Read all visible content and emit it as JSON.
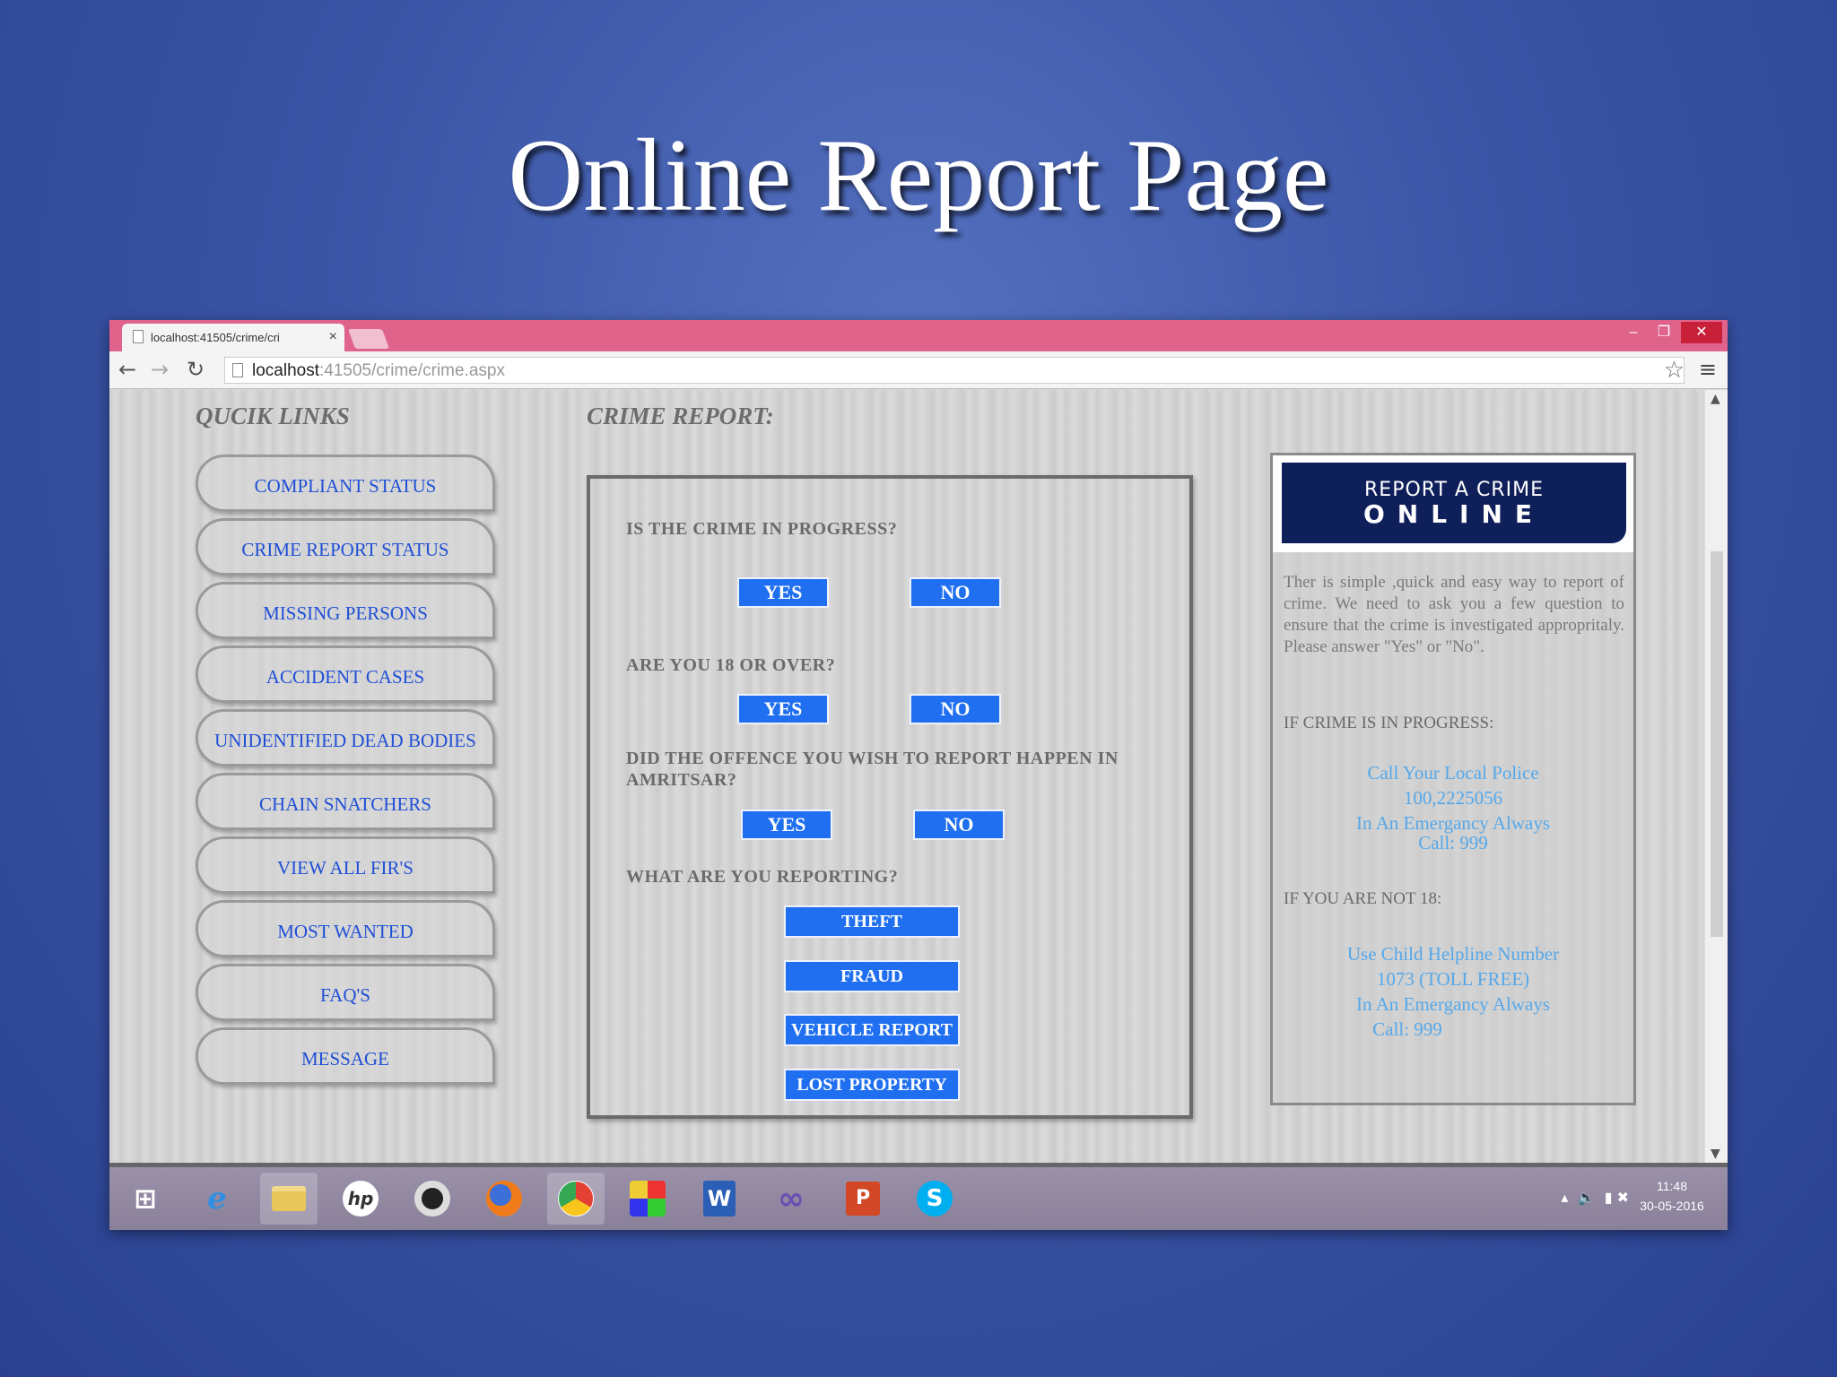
{
  "slide_title": "Online Report Page",
  "browser": {
    "tab_title": "localhost:41505/crime/cri",
    "url_host": "localhost",
    "url_rest": ":41505/crime/crime.aspx"
  },
  "quick_links": {
    "heading": "QUCIK LINKS",
    "items": [
      "COMPLIANT STATUS",
      "CRIME REPORT STATUS",
      "MISSING PERSONS",
      "ACCIDENT CASES",
      "UNIDENTIFIED DEAD BODIES",
      "CHAIN SNATCHERS",
      "VIEW ALL FIR'S",
      "MOST WANTED",
      "FAQ'S",
      "MESSAGE"
    ]
  },
  "crime_report": {
    "heading": "CRIME REPORT:",
    "q1": "IS THE CRIME IN PROGRESS?",
    "q2": "ARE YOU 18 OR OVER?",
    "q3": "DID THE OFFENCE YOU WISH TO REPORT HAPPEN IN AMRITSAR?",
    "q4": "WHAT ARE YOU REPORTING?",
    "yes_label": "YES",
    "no_label": "NO",
    "report_types": [
      "THEFT",
      "FRAUD",
      "VEHICLE REPORT",
      "LOST PROPERTY"
    ]
  },
  "info": {
    "banner_line1": "REPORT A CRIME",
    "banner_line2": "ONLINE",
    "intro": "Ther is simple ,quick and easy way to report of crime. We need to ask you a few question to ensure that the crime is investigated appropritaly. Please answer \"Yes\" or \"No\".",
    "in_progress_label": "IF CRIME IS IN PROGRESS:",
    "in_progress_lines": [
      "Call Your Local Police",
      "100,2225056",
      "In An Emergancy Always",
      "Call: 999"
    ],
    "not18_label": "IF YOU ARE NOT 18:",
    "not18_lines": [
      "Use Child Helpline Number",
      "1073 (TOLL FREE)",
      "In An Emergancy Always",
      "Call: 999"
    ]
  },
  "taskbar": {
    "apps": [
      "windows-start",
      "internet-explorer",
      "file-explorer",
      "hp",
      "webcam",
      "firefox",
      "chrome",
      "media-app",
      "word",
      "visual-studio",
      "powerpoint",
      "skype"
    ],
    "time": "11:48",
    "date": "30-05-2016"
  }
}
